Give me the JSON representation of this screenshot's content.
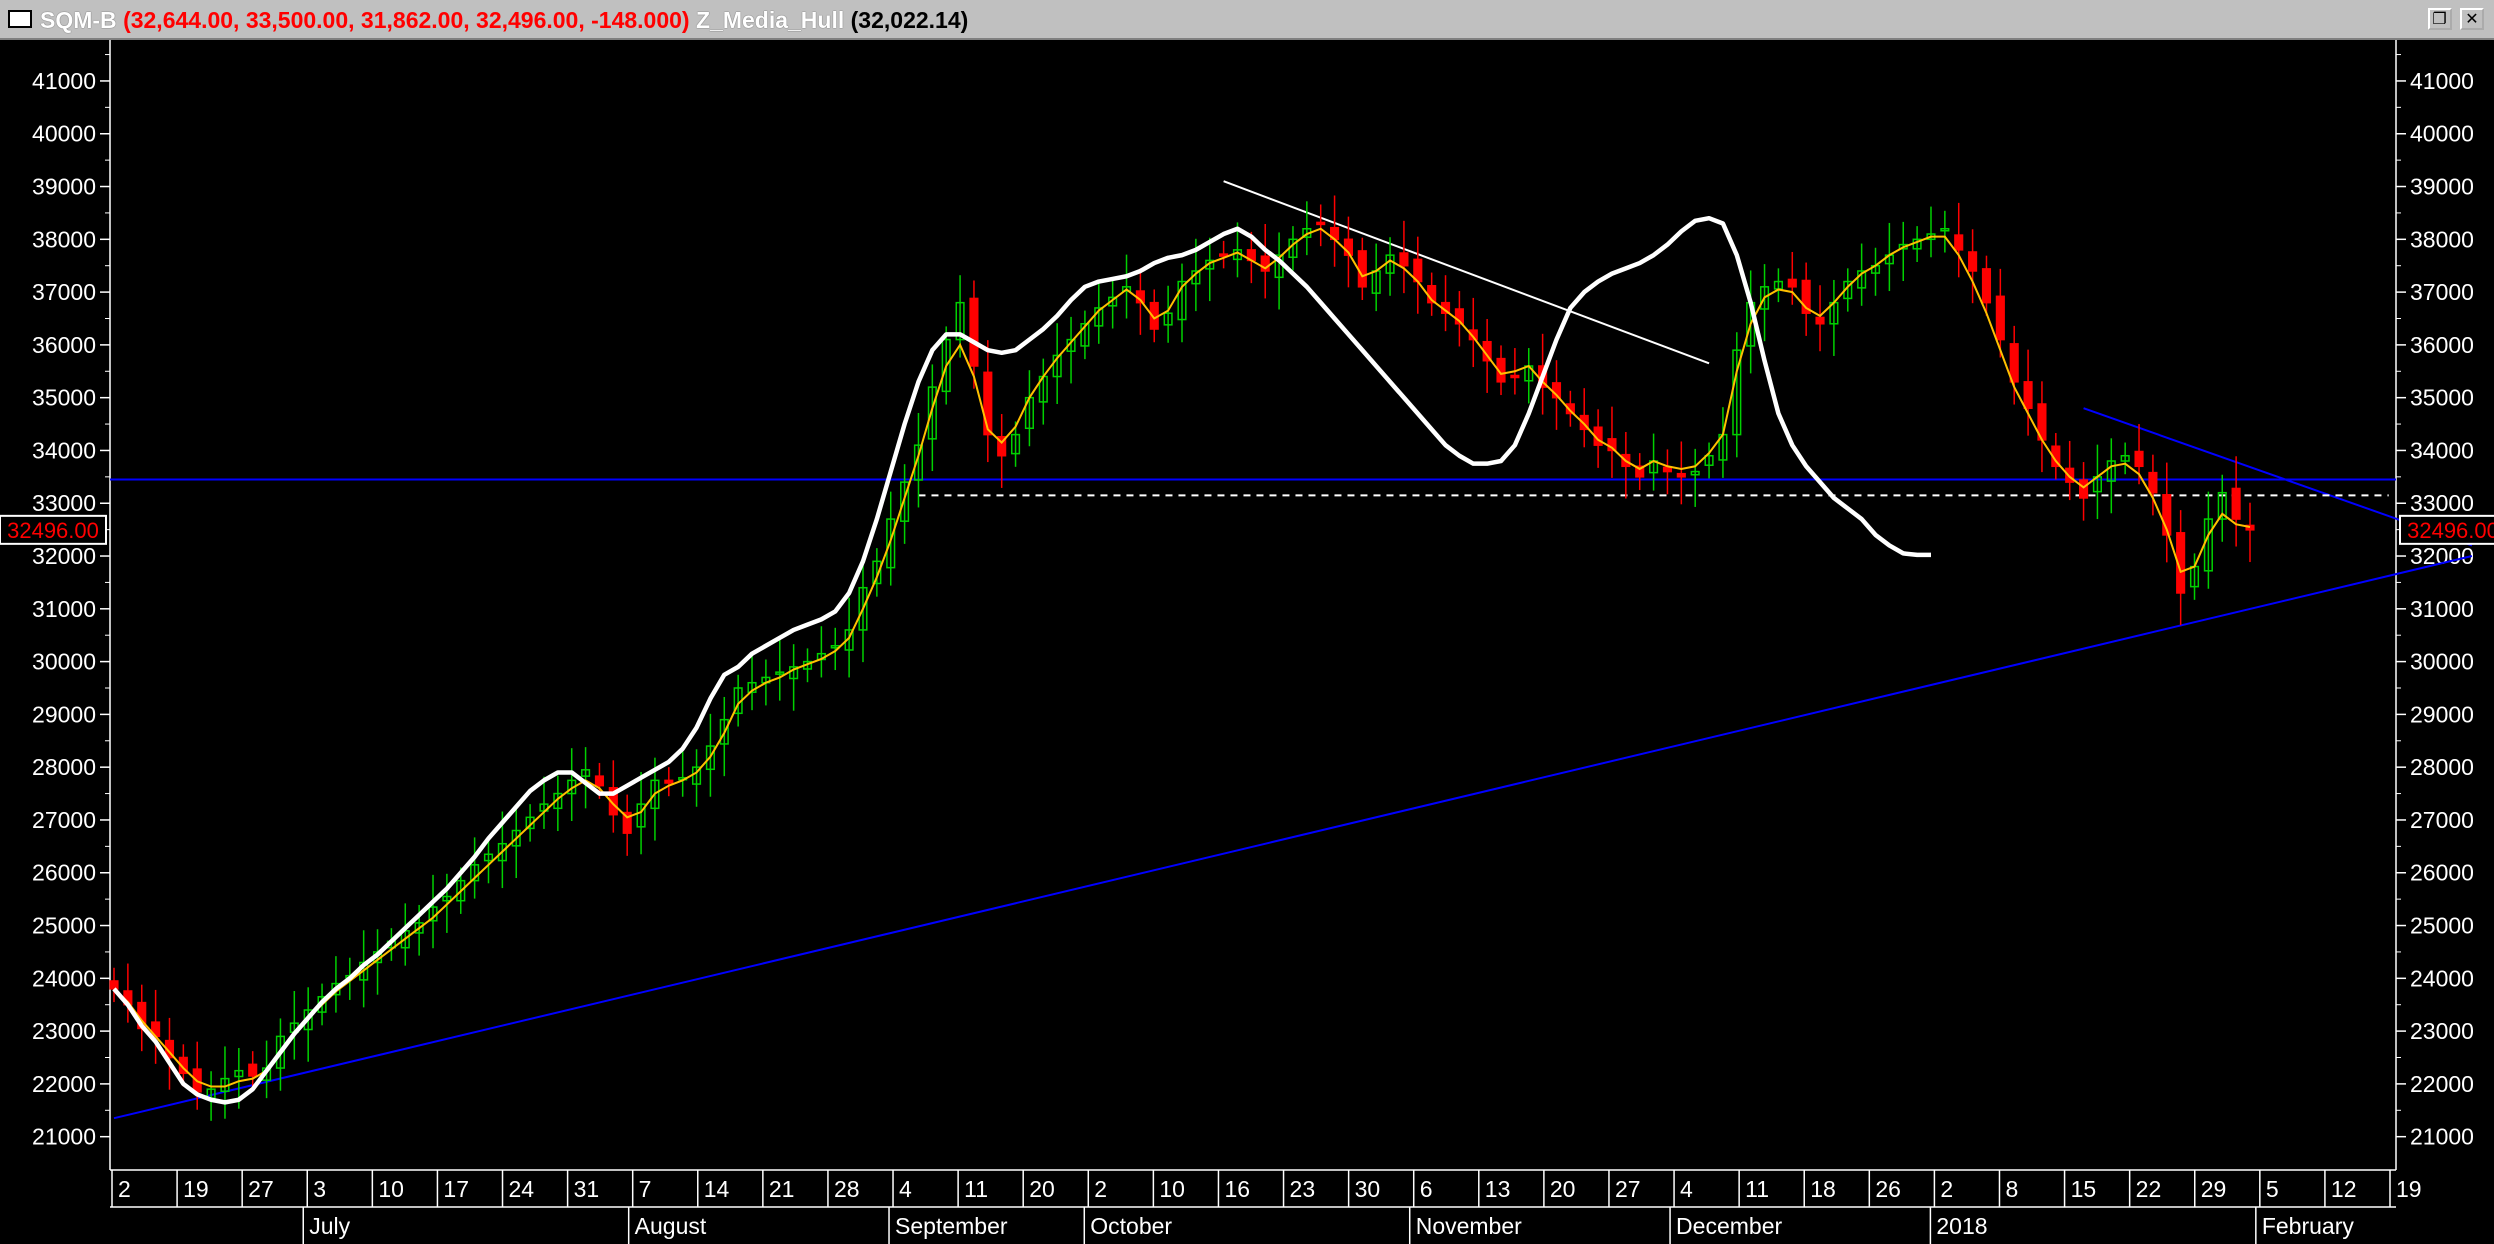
{
  "window": {
    "symbol": "SQM-B",
    "ohlc": "(32,644.00, 33,500.00, 31,862.00, 32,496.00, -148.000)",
    "indicator": "Z_Media_Hull",
    "indicator_value": "(32,022.14)",
    "restore_icon": "restore-window-icon",
    "close_icon": "close-window-icon"
  },
  "chart_data": {
    "type": "candlestick",
    "title": "",
    "xlabel": "",
    "ylabel": "",
    "ylim": [
      20400,
      41700
    ],
    "y_ticks": [
      21000,
      22000,
      23000,
      24000,
      25000,
      26000,
      27000,
      28000,
      29000,
      30000,
      31000,
      32000,
      33000,
      34000,
      35000,
      36000,
      37000,
      38000,
      39000,
      40000,
      41000
    ],
    "last_price_label": "32496.00",
    "x_day_ticks": [
      "2",
      "19",
      "27",
      "3",
      "10",
      "17",
      "24",
      "31",
      "7",
      "14",
      "21",
      "28",
      "4",
      "11",
      "20",
      "2",
      "10",
      "16",
      "23",
      "30",
      "6",
      "13",
      "20",
      "27",
      "4",
      "11",
      "18",
      "26",
      "2",
      "8",
      "15",
      "22",
      "29",
      "5",
      "12",
      "19"
    ],
    "x_month_labels": [
      "July",
      "August",
      "September",
      "October",
      "November",
      "December",
      "2018",
      "February"
    ],
    "colors": {
      "background": "#000000",
      "up_candle": "#00d000",
      "down_candle": "#ff0000",
      "hull_line": "#ffffff",
      "fast_ma": "#ffc000",
      "trend_line": "#0000ff",
      "support_dashed": "#ffffff"
    },
    "series": [
      {
        "key": "price",
        "values": [
          23800,
          23500,
          23050,
          22900,
          22500,
          22200,
          21850,
          21900,
          22100,
          22250,
          22150,
          22300,
          22900,
          23150,
          23400,
          23650,
          23900,
          24050,
          24300,
          24500,
          24700,
          24900,
          25050,
          25350,
          25550,
          25850,
          26150,
          26350,
          26550,
          26800,
          27050,
          27300,
          27500,
          27750,
          27950,
          27650,
          27100,
          26750,
          27300,
          27750,
          27700,
          27800,
          28000,
          28400,
          28900,
          29500,
          29600,
          29700,
          29800,
          29900,
          30000,
          30150,
          30300,
          30600,
          31400,
          31900,
          32700,
          33400,
          34100,
          35200,
          36100,
          36800,
          35600,
          34300,
          33900,
          34300,
          35000,
          35400,
          35800,
          36100,
          36400,
          36700,
          36900,
          37100,
          36800,
          36300,
          36600,
          37200,
          37400,
          37600,
          37700,
          37800,
          37600,
          37400,
          37700,
          38000,
          38200,
          38300,
          38000,
          37700,
          37100,
          37400,
          37700,
          37500,
          37200,
          36800,
          36600,
          36400,
          36100,
          35700,
          35300,
          35400,
          35600,
          35200,
          35000,
          34700,
          34400,
          34100,
          34000,
          33700,
          33500,
          33800,
          33600,
          33500,
          33600,
          33900,
          34300,
          35900,
          36800,
          37100,
          37200,
          37100,
          36600,
          36400,
          36800,
          37200,
          37400,
          37500,
          37700,
          37900,
          38000,
          38100,
          38200,
          37800,
          37400,
          36800,
          36100,
          35300,
          34800,
          34200,
          33700,
          33400,
          33100,
          33500,
          33800,
          33900,
          33700,
          33200,
          32400,
          31300,
          31800,
          32700,
          33200,
          32700,
          32496
        ]
      },
      {
        "key": "hull",
        "values": [
          23800,
          23500,
          23100,
          22800,
          22400,
          22000,
          21800,
          21700,
          21650,
          21700,
          21900,
          22250,
          22600,
          22950,
          23250,
          23550,
          23800,
          24000,
          24250,
          24450,
          24700,
          24950,
          25200,
          25450,
          25700,
          26000,
          26300,
          26650,
          26950,
          27250,
          27550,
          27750,
          27900,
          27900,
          27700,
          27500,
          27500,
          27650,
          27800,
          27950,
          28100,
          28350,
          28750,
          29300,
          29750,
          29900,
          30150,
          30300,
          30450,
          30600,
          30700,
          30800,
          30950,
          31300,
          31900,
          32700,
          33600,
          34500,
          35300,
          35900,
          36200,
          36200,
          36050,
          35900,
          35850,
          35900,
          36100,
          36300,
          36550,
          36850,
          37100,
          37200,
          37250,
          37300,
          37400,
          37550,
          37650,
          37700,
          37800,
          37950,
          38100,
          38200,
          38050,
          37800,
          37600,
          37350,
          37100,
          36800,
          36500,
          36200,
          35900,
          35600,
          35300,
          35000,
          34700,
          34400,
          34100,
          33900,
          33750,
          33750,
          33800,
          34100,
          34700,
          35400,
          36100,
          36700,
          37000,
          37200,
          37350,
          37450,
          37550,
          37700,
          37900,
          38150,
          38350,
          38400,
          38300,
          37700,
          36800,
          35700,
          34700,
          34100,
          33700,
          33400,
          33100,
          32900,
          32700,
          32400,
          32200,
          32050,
          32022,
          32022
        ]
      },
      {
        "key": "fast_ma",
        "values": [
          23800,
          23550,
          23200,
          22900,
          22600,
          22300,
          22050,
          21950,
          21950,
          22050,
          22100,
          22250,
          22600,
          22950,
          23250,
          23500,
          23750,
          23950,
          24150,
          24350,
          24550,
          24750,
          24950,
          25150,
          25400,
          25650,
          25900,
          26150,
          26400,
          26650,
          26900,
          27150,
          27400,
          27600,
          27750,
          27600,
          27300,
          27050,
          27150,
          27500,
          27650,
          27750,
          27900,
          28200,
          28650,
          29200,
          29450,
          29600,
          29700,
          29850,
          29950,
          30050,
          30200,
          30450,
          31000,
          31600,
          32300,
          33100,
          33900,
          34800,
          35600,
          36000,
          35400,
          34400,
          34150,
          34450,
          35000,
          35400,
          35750,
          36050,
          36350,
          36650,
          36850,
          37050,
          36850,
          36500,
          36650,
          37100,
          37350,
          37550,
          37650,
          37750,
          37600,
          37450,
          37650,
          37900,
          38100,
          38200,
          38000,
          37750,
          37300,
          37400,
          37600,
          37450,
          37200,
          36850,
          36650,
          36450,
          36150,
          35800,
          35450,
          35500,
          35600,
          35300,
          35050,
          34750,
          34500,
          34200,
          34050,
          33800,
          33650,
          33800,
          33700,
          33650,
          33700,
          33950,
          34300,
          35500,
          36400,
          36900,
          37050,
          37000,
          36700,
          36550,
          36800,
          37100,
          37350,
          37500,
          37700,
          37850,
          37950,
          38050,
          38050,
          37700,
          37200,
          36600,
          35900,
          35200,
          34700,
          34200,
          33800,
          33500,
          33300,
          33500,
          33700,
          33750,
          33550,
          33100,
          32500,
          31700,
          31800,
          32400,
          32800,
          32600,
          32550
        ]
      }
    ],
    "annotations": [
      {
        "type": "trendline",
        "color": "blue",
        "from": [
          0,
          21350
        ],
        "to": [
          170,
          32000
        ]
      },
      {
        "type": "trendline",
        "color": "blue",
        "from": [
          142,
          34800
        ],
        "to": [
          170,
          32200
        ]
      },
      {
        "type": "hline",
        "color": "blue",
        "value": 33450
      },
      {
        "type": "hline_dashed",
        "color": "white",
        "value": 33150,
        "from": 58,
        "to": 164
      },
      {
        "type": "trendline",
        "color": "white",
        "from": [
          80,
          39100
        ],
        "to": [
          115,
          35650
        ]
      }
    ]
  }
}
